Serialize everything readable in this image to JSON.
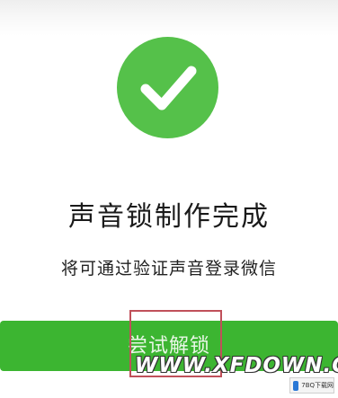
{
  "result": {
    "title": "声音锁制作完成",
    "subtitle": "将可通过验证声音登录微信"
  },
  "actions": {
    "try_unlock_label": "尝试解锁"
  },
  "overlay": {
    "watermark_text": "WWW.XFDOWN.COM",
    "badge_text": "7BQ下载网",
    "highlight_color": "#c0505a"
  },
  "icons": {
    "success": "checkmark-icon"
  },
  "colors": {
    "success_green": "#55c14a",
    "button_green": "#3cb531"
  }
}
